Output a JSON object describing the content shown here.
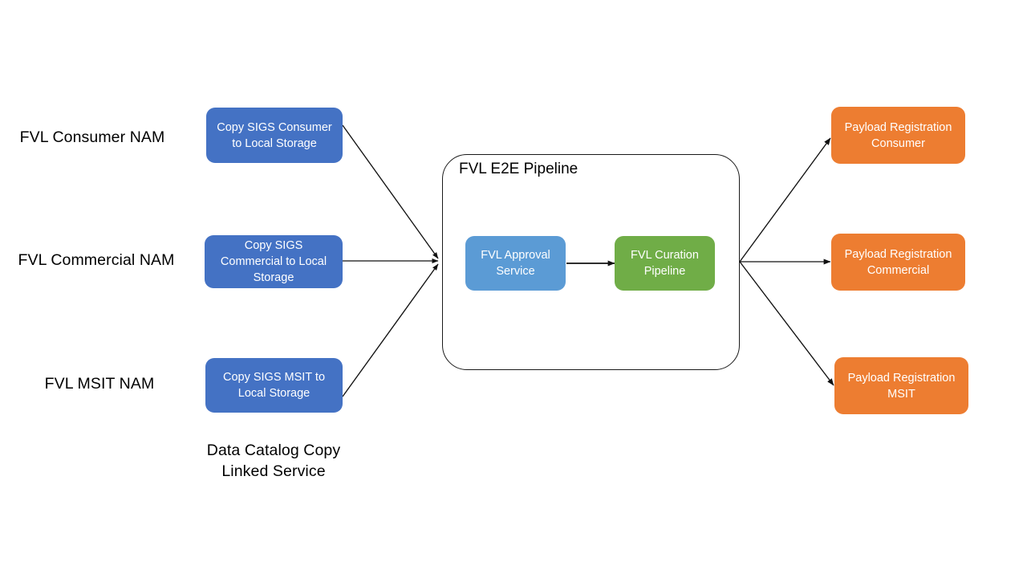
{
  "diagram": {
    "title": "FVL E2E Pipeline data flow",
    "background": "#ffffff",
    "palette": {
      "blue_dark": "#4472C4",
      "blue_light": "#5B9BD5",
      "green": "#70AD47",
      "orange": "#ED7D31",
      "outline": "#1a1a1a",
      "text_dark": "#000000",
      "text_light": "#ffffff"
    }
  },
  "source_labels": [
    {
      "text": "FVL Consumer  NAM"
    },
    {
      "text": "FVL Commercial NAM"
    },
    {
      "text": "FVL MSIT NAM"
    }
  ],
  "copy_nodes": [
    {
      "text": "Copy SIGS Consumer\nto Local Storage",
      "color": "#4472C4"
    },
    {
      "text": "Copy SIGS\nCommercial to Local\nStorage",
      "color": "#4472C4"
    },
    {
      "text": "Copy SIGS MSIT to\nLocal Storage",
      "color": "#4472C4"
    }
  ],
  "copy_group_caption": "Data Catalog Copy\nLinked Service",
  "pipeline": {
    "title": "FVL E2E Pipeline",
    "stages": [
      {
        "text": "FVL Approval\nService",
        "color": "#5B9BD5"
      },
      {
        "text": "FVL Curation\nPipeline",
        "color": "#70AD47"
      }
    ]
  },
  "registration_nodes": [
    {
      "text": "Payload Registration\nConsumer",
      "color": "#ED7D31"
    },
    {
      "text": "Payload Registration\nCommercial",
      "color": "#ED7D31"
    },
    {
      "text": "Payload Registration\nMSIT",
      "color": "#ED7D31"
    }
  ]
}
